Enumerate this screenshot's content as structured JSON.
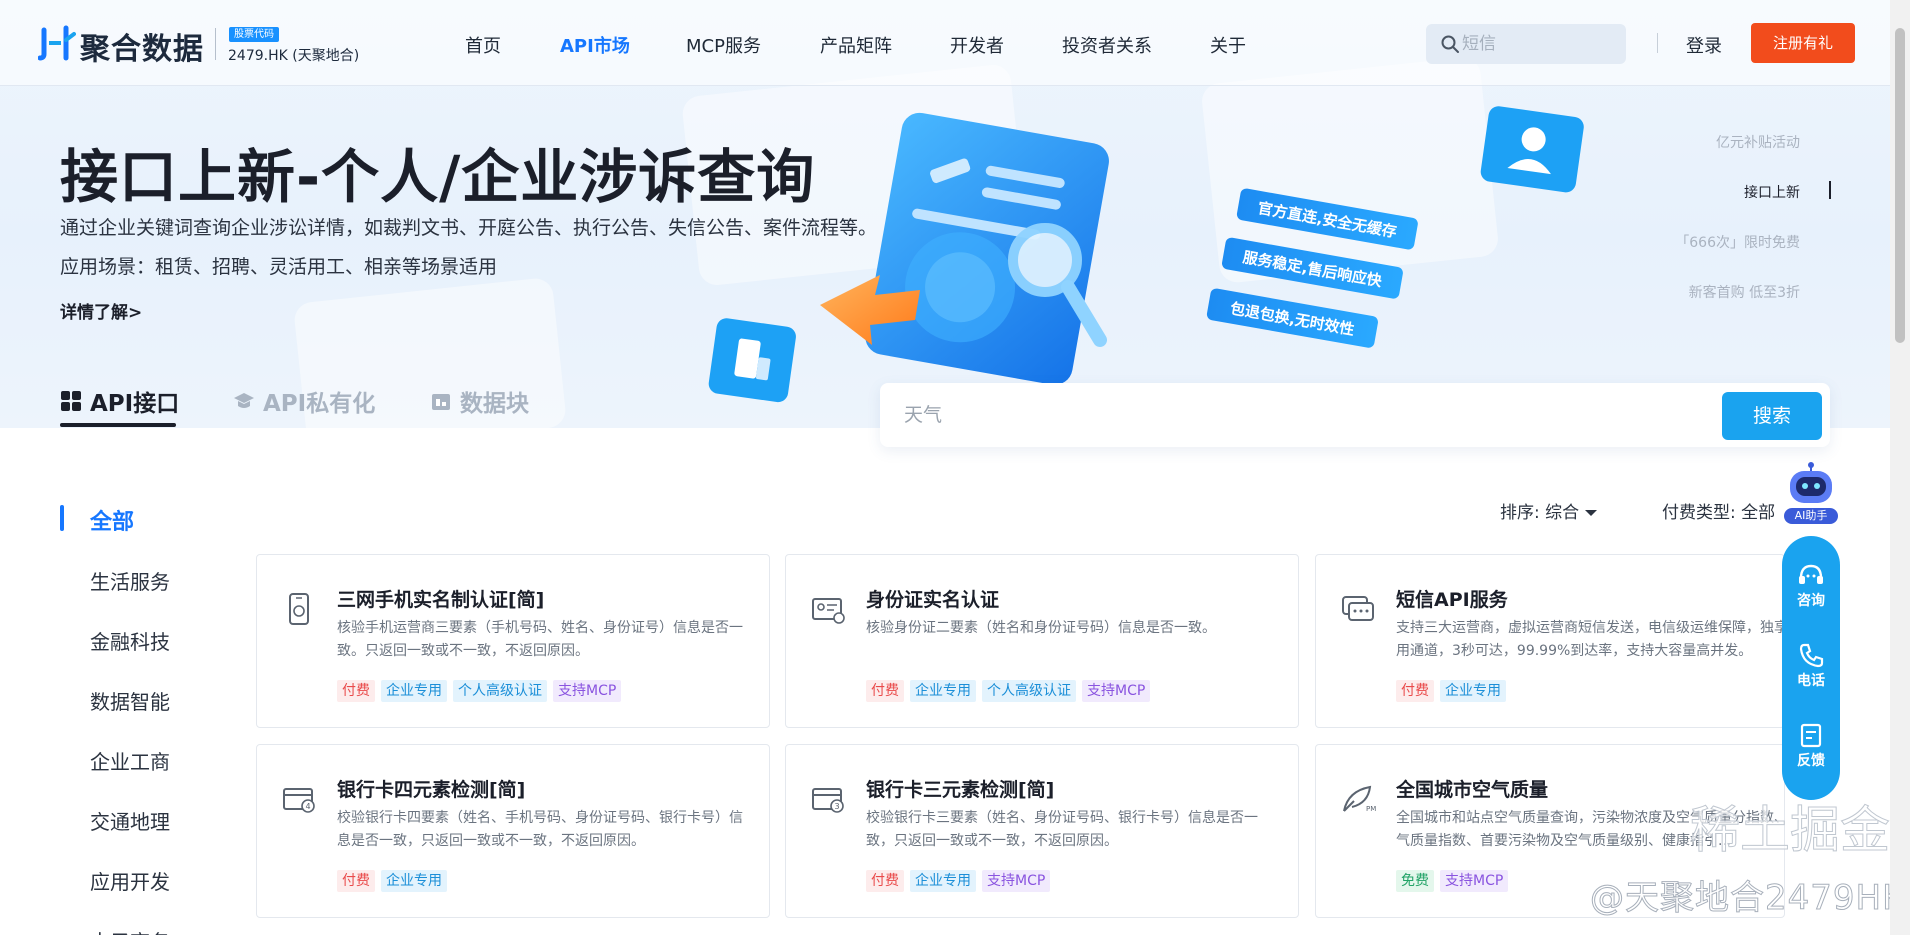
{
  "nav": {
    "brand": "聚合数据",
    "stock_badge": "股票代码",
    "stock_code": "2479.HK (天聚地合)",
    "items": [
      "首页",
      "API市场",
      "MCP服务",
      "产品矩阵",
      "开发者",
      "投资者关系",
      "关于"
    ],
    "active_index": 1,
    "search_placeholder": "短信",
    "login": "登录",
    "register": "注册有礼"
  },
  "hero": {
    "title": "接口上新-个人/企业涉诉查询",
    "desc": "通过企业关键词查询企业涉讼详情，如裁判文书、开庭公告、执行公告、失信公告、案件流程等。",
    "scene": "应用场景：租赁、招聘、灵活用工、相亲等场景适用",
    "more": "详情了解>",
    "badges": [
      "官方直连,安全无缓存",
      "服务稳定,售后响应快",
      "包退包换,无时效性"
    ],
    "carousel": [
      "亿元补贴活动",
      "接口上新",
      "「666次」限时免费",
      "新客首购 低至3折"
    ],
    "carousel_active": 1
  },
  "tabs": [
    {
      "label": "API接口",
      "icon": "grid-icon",
      "active": true
    },
    {
      "label": "API私有化",
      "icon": "graduation-cap-icon",
      "active": false
    },
    {
      "label": "数据块",
      "icon": "data-block-icon",
      "active": false
    }
  ],
  "search": {
    "placeholder": "天气",
    "button": "搜索"
  },
  "sidebar": {
    "items": [
      "全部",
      "生活服务",
      "金融科技",
      "数据智能",
      "企业工商",
      "交通地理",
      "应用开发",
      "电子商务"
    ],
    "active_index": 0
  },
  "filters": {
    "sort_label": "排序:",
    "sort_value": "综合",
    "pay_label": "付费类型:",
    "pay_value": "全部"
  },
  "cards": [
    {
      "title": "三网手机实名制认证[简]",
      "desc": "核验手机运营商三要素（手机号码、姓名、身份证号）信息是否一致。只返回一致或不一致，不返回原因。",
      "icon": "phone-verify-icon",
      "tags": [
        {
          "text": "付费",
          "kind": "pay"
        },
        {
          "text": "企业专用",
          "kind": "ent"
        },
        {
          "text": "个人高级认证",
          "kind": "adv"
        },
        {
          "text": "支持MCP",
          "kind": "mcp"
        }
      ]
    },
    {
      "title": "身份证实名认证",
      "desc": "核验身份证二要素（姓名和身份证号码）信息是否一致。",
      "icon": "id-card-icon",
      "tags": [
        {
          "text": "付费",
          "kind": "pay"
        },
        {
          "text": "企业专用",
          "kind": "ent"
        },
        {
          "text": "个人高级认证",
          "kind": "adv"
        },
        {
          "text": "支持MCP",
          "kind": "mcp"
        }
      ]
    },
    {
      "title": "短信API服务",
      "desc": "支持三大运营商，虚拟运营商短信发送，电信级运维保障，独享专用通道，3秒可达，99.99%到达率，支持大容量高并发。",
      "icon": "sms-icon",
      "tags": [
        {
          "text": "付费",
          "kind": "pay"
        },
        {
          "text": "企业专用",
          "kind": "ent"
        }
      ]
    },
    {
      "title": "银行卡四元素检测[简]",
      "desc": "校验银行卡四要素（姓名、手机号码、身份证号码、银行卡号）信息是否一致，只返回一致或不一致，不返回原因。",
      "icon": "bank-card-4-icon",
      "tags": [
        {
          "text": "付费",
          "kind": "pay"
        },
        {
          "text": "企业专用",
          "kind": "ent"
        }
      ]
    },
    {
      "title": "银行卡三元素检测[简]",
      "desc": "校验银行卡三要素（姓名、身份证号码、银行卡号）信息是否一致，只返回一致或不一致，不返回原因。",
      "icon": "bank-card-3-icon",
      "tags": [
        {
          "text": "付费",
          "kind": "pay"
        },
        {
          "text": "企业专用",
          "kind": "ent"
        },
        {
          "text": "支持MCP",
          "kind": "mcp"
        }
      ]
    },
    {
      "title": "全国城市空气质量",
      "desc": "全国城市和站点空气质量查询，污染物浓度及空气质量分指数、空气质量指数、首要污染物及空气质量级别、健康指引...",
      "icon": "air-quality-icon",
      "tags": [
        {
          "text": "免费",
          "kind": "free"
        },
        {
          "text": "支持MCP",
          "kind": "mcp"
        }
      ]
    }
  ],
  "float": {
    "ai_label": "AI助手",
    "items": [
      {
        "label": "咨询",
        "icon": "headset-icon"
      },
      {
        "label": "电话",
        "icon": "phone-icon"
      },
      {
        "label": "反馈",
        "icon": "feedback-icon"
      }
    ]
  },
  "watermark": "@天聚地合2479HK",
  "watermark2": "稀土掘金社区"
}
